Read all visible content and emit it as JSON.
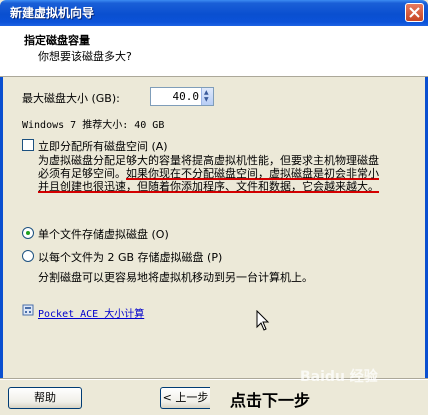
{
  "window": {
    "title": "新建虚拟机向导"
  },
  "header": {
    "title": "指定磁盘容量",
    "subtitle": "你想要该磁盘多大?"
  },
  "disk": {
    "max_label": "最大磁盘大小 (GB):",
    "value": "40.0",
    "recommend": "Windows 7 推荐大小: 40 GB"
  },
  "allocate": {
    "label": "立即分配所有磁盘空间 (A)",
    "checked": false,
    "desc_line1": "为虚拟磁盘分配足够大的容量将提高虚拟机性能，但要求主机物理磁盘",
    "desc_line2a": "必须有足够空间。",
    "desc_line2b": "如果你现在不分配磁盘空间，虚拟磁盘是初会非常小",
    "desc_line3": "并且创建也很迅速，但随着你添加程序、文件和数据，它会越来越大。"
  },
  "storage": {
    "single_label": "单个文件存储虚拟磁盘 (O)",
    "split_label": "以每个文件为 2 GB 存储虚拟磁盘 (P)",
    "split_desc": "分割磁盘可以更容易地将虚拟机移动到另一台计算机上。",
    "selected": "single"
  },
  "link": {
    "text": "Pocket ACE 大小计算"
  },
  "footer": {
    "help_label": "帮助",
    "back_label": "< 上一步",
    "hint": "点击下一步",
    "watermark": "Baidu 经验"
  },
  "colors": {
    "titlebar": "#0a4fd0",
    "underline": "#d40000",
    "link": "#0000cc"
  }
}
